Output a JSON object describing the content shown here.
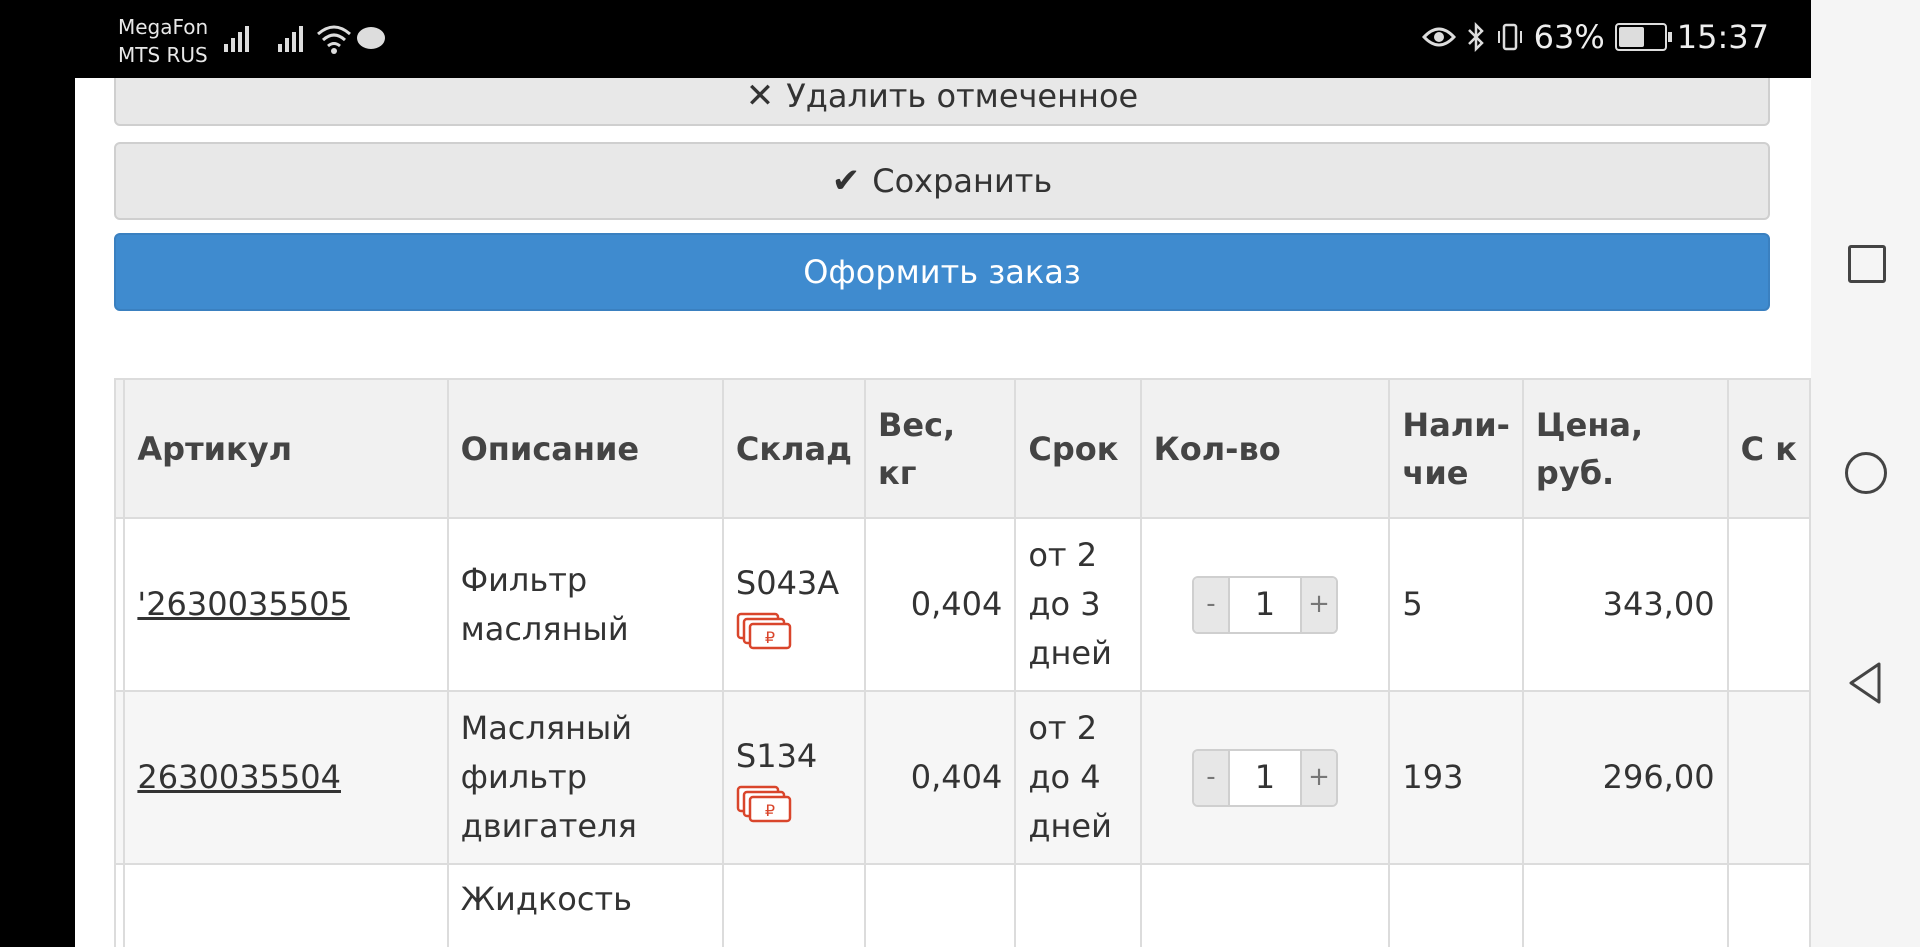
{
  "status_bar": {
    "carrier_1": "MegaFon",
    "carrier_2": "MTS RUS",
    "battery_percent": "63%",
    "battery_level": 0.63,
    "time": "15:37"
  },
  "actions": {
    "delete_label": "Удалить отмеченное",
    "save_label": "Сохранить",
    "order_label": "Оформить заказ"
  },
  "table": {
    "headers": {
      "article": "Артикул",
      "description": "Описание",
      "warehouse": "Склад",
      "weight": "Вес, кг",
      "term": "Срок",
      "qty": "Кол-во",
      "availability": "Нали-чие",
      "price": "Цена, руб.",
      "next_partial": "С к"
    },
    "rows": [
      {
        "article": "'2630035505",
        "description": "Фильтр масляный",
        "warehouse": "S043A",
        "weight": "0,404",
        "term": "от 2 до 3 дней",
        "qty": "1",
        "availability": "5",
        "price": "343,00"
      },
      {
        "article": "2630035504",
        "description": "Масляный фильтр двигателя",
        "warehouse": "S134",
        "weight": "0,404",
        "term": "от 2 до 4 дней",
        "qty": "1",
        "availability": "193",
        "price": "296,00"
      },
      {
        "description": "Жидкость"
      }
    ],
    "qty_minus": "-",
    "qty_plus": "+"
  },
  "icons": {
    "delete": "times-icon",
    "save": "check-icon",
    "payment": "ruble-cards-icon",
    "accent_payment": "#d9452b",
    "accent_primary": "#3f8bcf"
  }
}
